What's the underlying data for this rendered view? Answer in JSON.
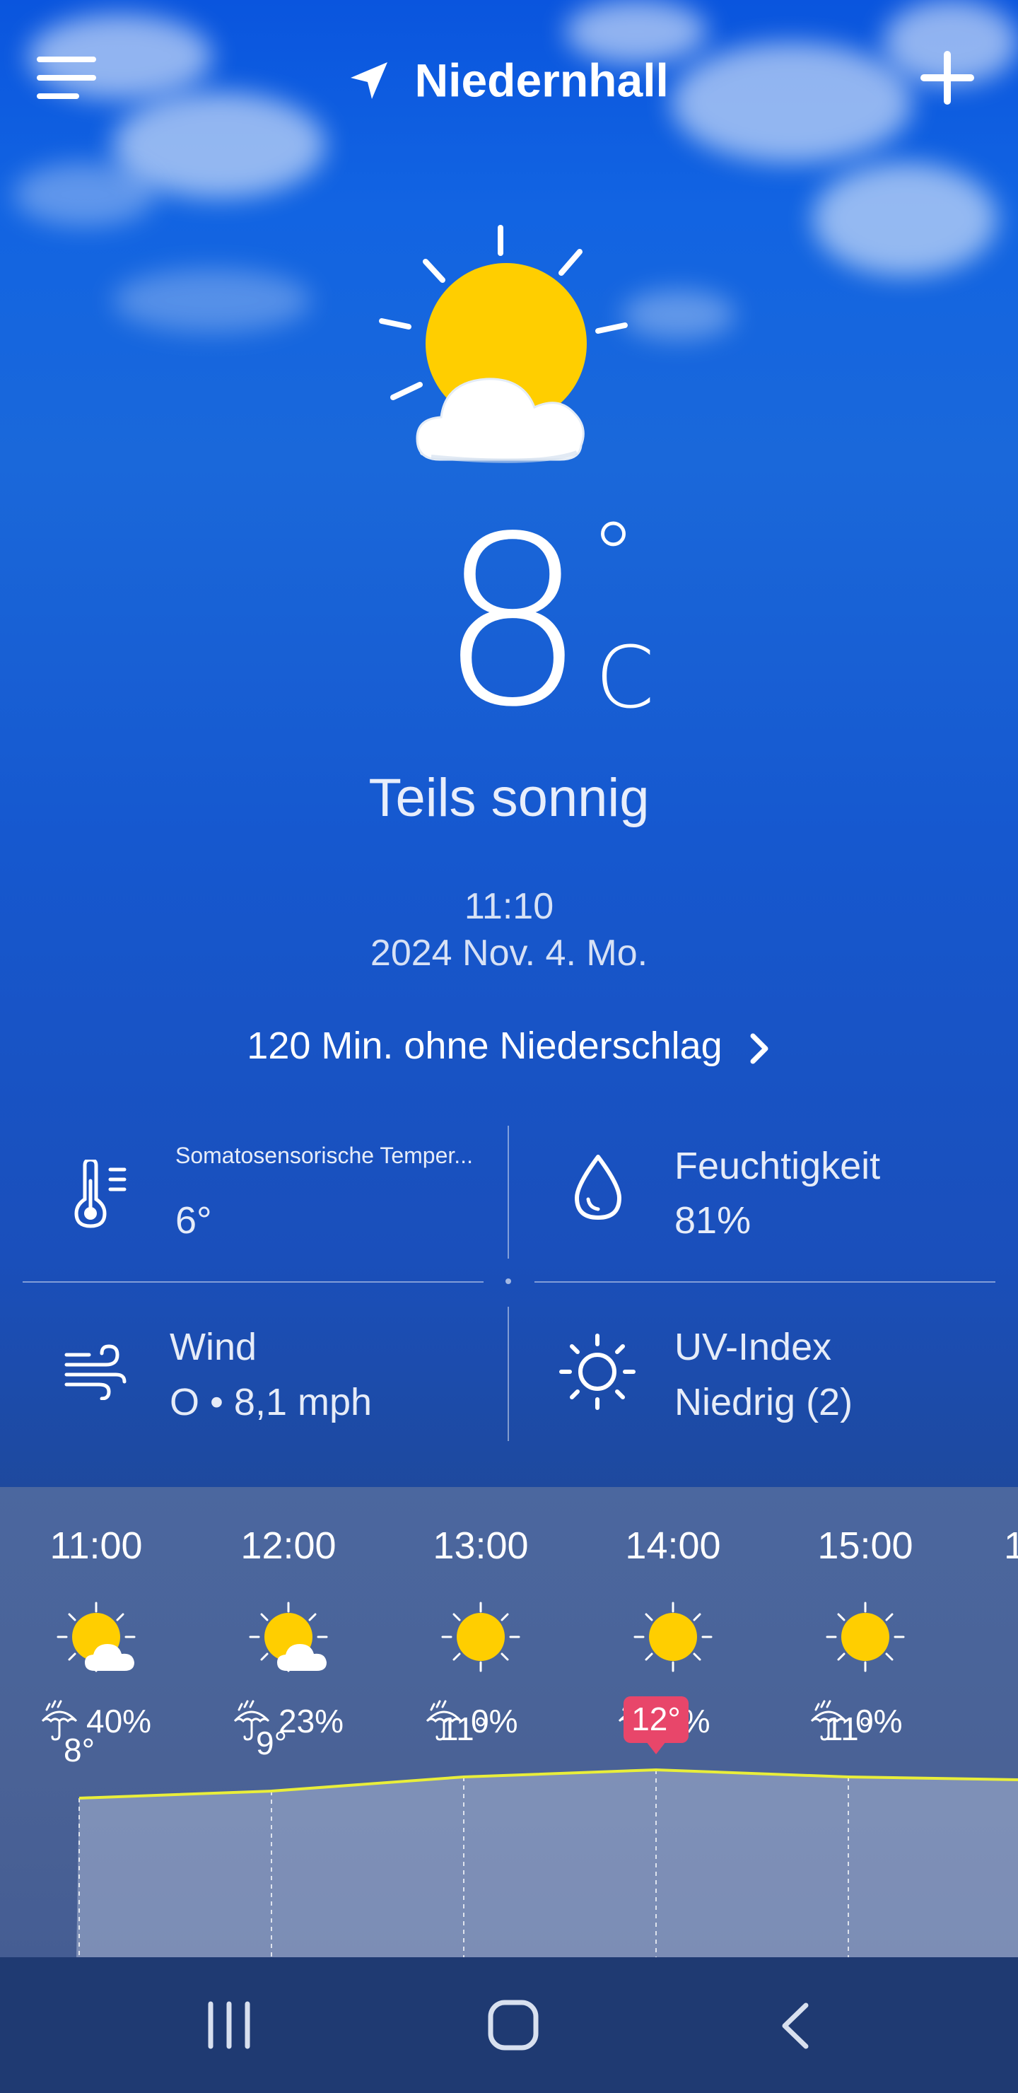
{
  "header": {
    "location": "Niedernhall",
    "menu_icon": "hamburger-menu-icon",
    "add_icon": "plus-icon",
    "location_icon": "location-arrow-icon"
  },
  "current": {
    "condition_icon": "partly-sunny-icon",
    "temperature": "8",
    "degree_symbol": "°",
    "unit": "C",
    "condition": "Teils sonnig",
    "time": "11:10",
    "date": "2024 Nov. 4. Mo.",
    "precipitation_notice": "120 Min. ohne Niederschlag"
  },
  "details": {
    "feels_like": {
      "label": "Somatosensorische Temper...",
      "value": "6°",
      "icon": "thermometer-icon"
    },
    "humidity": {
      "label": "Feuchtigkeit",
      "value": "81%",
      "icon": "water-drop-icon"
    },
    "wind": {
      "label": "Wind",
      "value": "O • 8,1 mph",
      "icon": "wind-icon"
    },
    "uv": {
      "label": "UV-Index",
      "value": "Niedrig (2)",
      "icon": "sun-icon"
    }
  },
  "hourly": [
    {
      "time": "11:00",
      "icon": "partly-sunny-icon",
      "rain": "40%",
      "temp": "8°",
      "temp_value": 8
    },
    {
      "time": "12:00",
      "icon": "partly-sunny-icon",
      "rain": "23%",
      "temp": "9°",
      "temp_value": 9
    },
    {
      "time": "13:00",
      "icon": "sunny-icon",
      "rain": "0%",
      "temp": "11°",
      "temp_value": 11
    },
    {
      "time": "14:00",
      "icon": "sunny-icon",
      "rain": "0%",
      "temp": "12°",
      "temp_value": 12,
      "highlight": true
    },
    {
      "time": "15:00",
      "icon": "sunny-icon",
      "rain": "0%",
      "temp": "11°",
      "temp_value": 11
    }
  ],
  "colors": {
    "sun": "#ffce00",
    "highlight": "#e8466a",
    "temp_line": "#e9ee3a"
  },
  "navbar": {
    "recents_icon": "recent-apps-icon",
    "home_icon": "home-icon",
    "back_icon": "back-icon"
  }
}
